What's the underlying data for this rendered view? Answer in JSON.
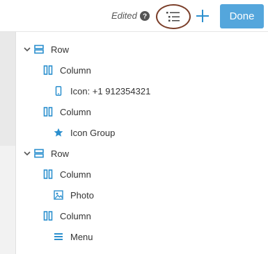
{
  "header": {
    "status_label": "Edited",
    "done_label": "Done"
  },
  "tree": [
    {
      "label": "Row",
      "type": "row",
      "expanded": true
    },
    {
      "label": "Column",
      "type": "column"
    },
    {
      "label": "Icon: +1 912354321",
      "type": "phone-icon-module"
    },
    {
      "label": "Column",
      "type": "column"
    },
    {
      "label": "Icon Group",
      "type": "icon-group"
    },
    {
      "label": "Row",
      "type": "row",
      "expanded": true
    },
    {
      "label": "Column",
      "type": "column"
    },
    {
      "label": "Photo",
      "type": "photo"
    },
    {
      "label": "Column",
      "type": "column"
    },
    {
      "label": "Menu",
      "type": "menu"
    }
  ],
  "colors": {
    "accent": "#2b8fce",
    "done_button": "#54a6dc",
    "highlight_ring": "#7b3f2a"
  }
}
